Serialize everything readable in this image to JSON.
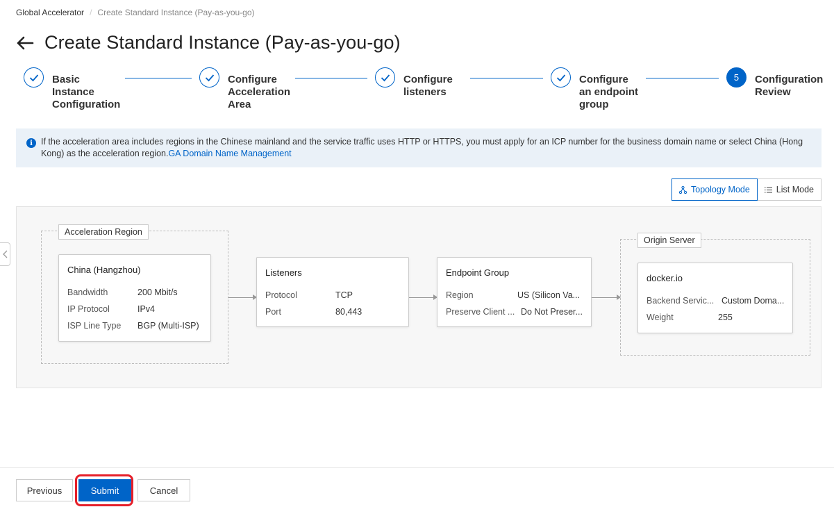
{
  "breadcrumb": {
    "root": "Global Accelerator",
    "separator": "/",
    "current": "Create Standard Instance (Pay-as-you-go)"
  },
  "header": {
    "title": "Create Standard Instance (Pay-as-you-go)"
  },
  "steps": [
    {
      "label": "Basic Instance Configuration",
      "state": "done"
    },
    {
      "label": "Configure Acceleration Area",
      "state": "done"
    },
    {
      "label": "Configure listeners",
      "state": "done"
    },
    {
      "label": "Configure an endpoint group",
      "state": "done"
    },
    {
      "label": "Configuration Review",
      "state": "active",
      "number": "5"
    }
  ],
  "notice": {
    "icon": "info-icon",
    "text": "If the acceleration area includes regions in the Chinese mainland and the service traffic uses HTTP or HTTPS, you must apply for an ICP number for the business domain name or select China (Hong Kong) as the acceleration region.",
    "link": "GA Domain Name Management"
  },
  "view_modes": {
    "topology": "Topology Mode",
    "list": "List Mode",
    "selected": "topology"
  },
  "topology": {
    "acceleration_region": {
      "group_title": "Acceleration Region",
      "node_title": "China (Hangzhou)",
      "rows": [
        {
          "key": "Bandwidth",
          "value": "200 Mbit/s"
        },
        {
          "key": "IP Protocol",
          "value": "IPv4"
        },
        {
          "key": "ISP Line Type",
          "value": "BGP (Multi-ISP)"
        }
      ]
    },
    "listeners": {
      "node_title": "Listeners",
      "rows": [
        {
          "key": "Protocol",
          "value": "TCP"
        },
        {
          "key": "Port",
          "value": "80,443"
        }
      ]
    },
    "endpoint_group": {
      "node_title": "Endpoint Group",
      "rows": [
        {
          "key": "Region",
          "value": "US (Silicon Va..."
        },
        {
          "key": "Preserve Client ...",
          "value": "Do Not Preser..."
        }
      ]
    },
    "origin_server": {
      "group_title": "Origin Server",
      "node_title": "docker.io",
      "rows": [
        {
          "key": "Backend Servic...",
          "value": "Custom Doma..."
        },
        {
          "key": "Weight",
          "value": "255"
        }
      ]
    }
  },
  "footer": {
    "previous": "Previous",
    "submit": "Submit",
    "cancel": "Cancel"
  },
  "colors": {
    "primary": "#0064c8",
    "highlight": "#e6202a",
    "notice_bg": "#eaf1f8"
  }
}
